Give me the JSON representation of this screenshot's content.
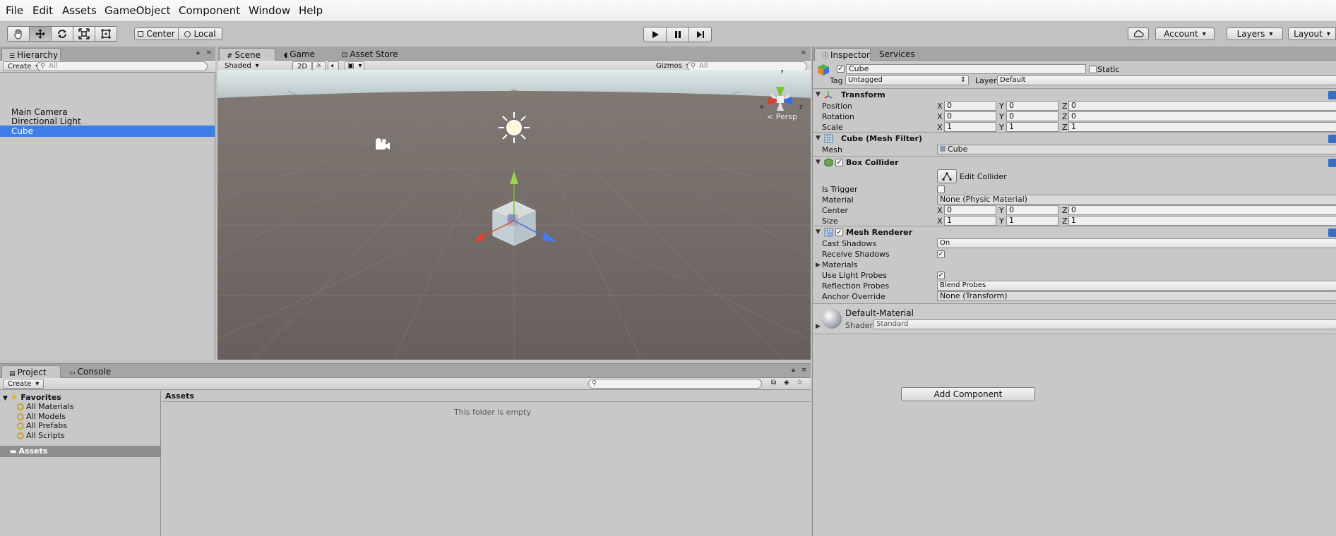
{
  "menu": [
    "File",
    "Edit",
    "Assets",
    "GameObject",
    "Component",
    "Window",
    "Help"
  ],
  "toolbar": {
    "pivot": "Center",
    "space": "Local",
    "account": "Account",
    "layers": "Layers",
    "layout": "Layout"
  },
  "hierarchy": {
    "tab": "Hierarchy",
    "create": "Create",
    "search_placeholder": "All",
    "items": [
      "Main Camera",
      "Directional Light",
      "Cube"
    ]
  },
  "scene": {
    "tabs": [
      "Scene",
      "Game",
      "Asset Store"
    ],
    "shading": "Shaded",
    "mode_2d": "2D",
    "gizmos": "Gizmos",
    "search_placeholder": "All",
    "persp": "Persp",
    "axis_x": "x",
    "axis_y": "y",
    "axis_z": "z"
  },
  "inspector": {
    "tabs": [
      "Inspector",
      "Services"
    ],
    "object_name": "Cube",
    "static_label": "Static",
    "tag_label": "Tag",
    "tag_value": "Untagged",
    "layer_label": "Layer",
    "layer_value": "Default",
    "transform": {
      "title": "Transform",
      "position_label": "Position",
      "rotation_label": "Rotation",
      "scale_label": "Scale",
      "position": [
        "0",
        "0",
        "0"
      ],
      "rotation": [
        "0",
        "0",
        "0"
      ],
      "scale": [
        "1",
        "1",
        "1"
      ]
    },
    "mesh_filter": {
      "title": "Cube (Mesh Filter)",
      "mesh_label": "Mesh",
      "mesh_value": "Cube"
    },
    "box_collider": {
      "title": "Box Collider",
      "edit_collider": "Edit Collider",
      "is_trigger_label": "Is Trigger",
      "material_label": "Material",
      "material_value": "None (Physic Material)",
      "center_label": "Center",
      "size_label": "Size",
      "center": [
        "0",
        "0",
        "0"
      ],
      "size": [
        "1",
        "1",
        "1"
      ]
    },
    "mesh_renderer": {
      "title": "Mesh Renderer",
      "cast_shadows_label": "Cast Shadows",
      "cast_shadows_value": "On",
      "receive_shadows_label": "Receive Shadows",
      "materials_label": "Materials",
      "light_probes_label": "Use Light Probes",
      "reflection_probes_label": "Reflection Probes",
      "reflection_probes_value": "Blend Probes",
      "anchor_override_label": "Anchor Override",
      "anchor_override_value": "None (Transform)"
    },
    "material": {
      "name": "Default-Material",
      "shader_label": "Shader",
      "shader_value": "Standard"
    },
    "add_component": "Add Component",
    "axis_labels": [
      "X",
      "Y",
      "Z"
    ]
  },
  "project": {
    "tabs": [
      "Project",
      "Console"
    ],
    "create": "Create",
    "favorites_label": "Favorites",
    "favorites": [
      "All Materials",
      "All Models",
      "All Prefabs",
      "All Scripts"
    ],
    "assets_root": "Assets",
    "assets_header": "Assets",
    "empty_text": "This folder is empty"
  },
  "colors": {
    "selection": "#3d7ee8",
    "panel": "#c8c8c8",
    "sky": "#d8e4e6",
    "ground": "#6a625e",
    "axis_x": "#d8412b",
    "axis_y": "#7ac22f",
    "axis_z": "#3a6ee0"
  }
}
